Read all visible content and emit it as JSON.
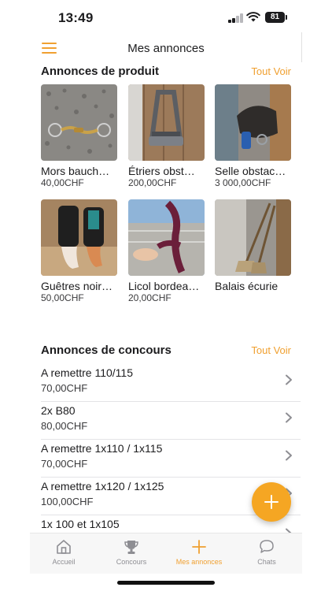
{
  "status_bar": {
    "time": "13:49",
    "battery": "81"
  },
  "nav": {
    "title": "Mes annonces",
    "menu_icon": "hamburger-menu-icon"
  },
  "products": {
    "title": "Annonces de produit",
    "see_all": "Tout Voir",
    "items": [
      {
        "name": "Mors bauch…",
        "price": "40,00CHF"
      },
      {
        "name": "Étriers obst…",
        "price": "200,00CHF"
      },
      {
        "name": "Selle obstac…",
        "price": "3 000,00CHF"
      },
      {
        "name": "Guêtres noir…",
        "price": "50,00CHF"
      },
      {
        "name": "Licol bordea…",
        "price": "20,00CHF"
      },
      {
        "name": "Balais écurie",
        "price": ""
      }
    ]
  },
  "contests": {
    "title": "Annonces de concours",
    "see_all": "Tout Voir",
    "items": [
      {
        "title": "A remettre 110/115",
        "price": "70,00CHF"
      },
      {
        "title": "2x B80",
        "price": "80,00CHF"
      },
      {
        "title": "A remettre 1x110 / 1x115",
        "price": "70,00CHF"
      },
      {
        "title": "A remettre 1x120 / 1x125",
        "price": "100,00CHF"
      },
      {
        "title": "1x 100 et 1x105",
        "price": ""
      }
    ]
  },
  "tabs": [
    {
      "label": "Accueil",
      "icon": "home-icon"
    },
    {
      "label": "Concours",
      "icon": "trophy-icon"
    },
    {
      "label": "Mes annonces",
      "icon": "plus-icon",
      "active": true
    },
    {
      "label": "Chats",
      "icon": "chat-bubble-icon"
    }
  ],
  "colors": {
    "accent": "#f0a030",
    "fab": "#f5a623",
    "text": "#1c1c1e",
    "secondary_text": "#3a3a3c"
  }
}
